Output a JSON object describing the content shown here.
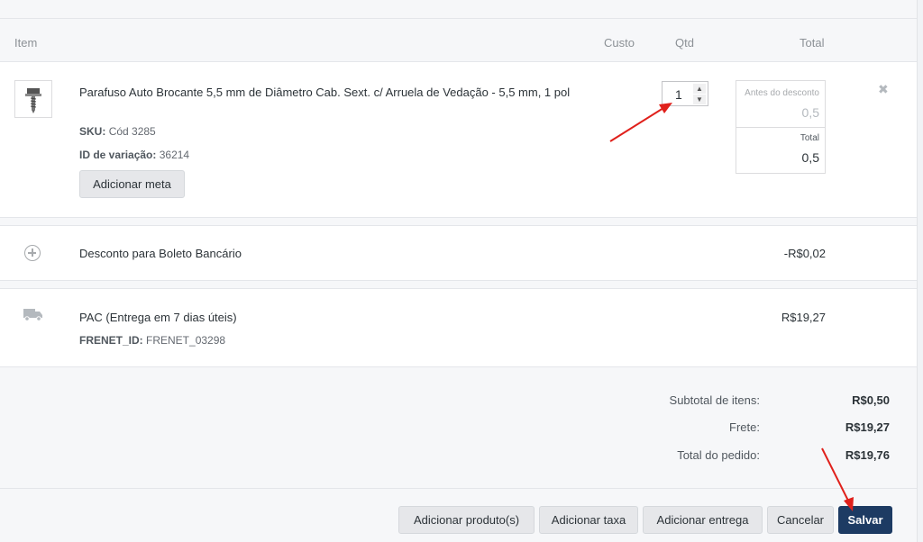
{
  "header": {
    "item": "Item",
    "custo": "Custo",
    "qtd": "Qtd",
    "total": "Total"
  },
  "product": {
    "name": "Parafuso Auto Brocante 5,5 mm de Diâmetro Cab. Sext. c/ Arruela de Vedação - 5,5 mm, 1 pol",
    "sku_label": "SKU:",
    "sku_value": "Cód 3285",
    "variation_label": "ID de variação:",
    "variation_value": "36214",
    "add_meta": "Adicionar meta",
    "qty": "1",
    "before_discount_label": "Antes do desconto",
    "before_discount_value": "0,5",
    "total_label": "Total",
    "total_value": "0,5"
  },
  "discount": {
    "label": "Desconto para Boleto Bancário",
    "value": "-R$0,02"
  },
  "shipping": {
    "label": "PAC (Entrega em 7 dias úteis)",
    "meta_key": "FRENET_ID:",
    "meta_value": "FRENET_03298",
    "value": "R$19,27"
  },
  "summary": {
    "subtotal_label": "Subtotal de itens:",
    "subtotal_value": "R$0,50",
    "shipping_label": "Frete:",
    "shipping_value": "R$19,27",
    "total_label": "Total do pedido:",
    "total_value": "R$19,76"
  },
  "actions": {
    "add_product": "Adicionar produto(s)",
    "add_fee": "Adicionar taxa",
    "add_shipping": "Adicionar entrega",
    "cancel": "Cancelar",
    "save": "Salvar"
  },
  "icons": {
    "remove": "close-icon",
    "add_coupon": "plus-circle-icon",
    "shipping": "truck-icon",
    "product": "screw-thumbnail"
  },
  "colors": {
    "primary": "#1d3b63",
    "annotation": "#e0201b"
  }
}
